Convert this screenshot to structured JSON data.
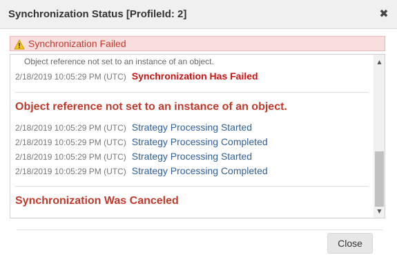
{
  "dialog": {
    "title": "Synchronization Status [ProfileId: 2]",
    "close_glyph": "✖"
  },
  "alert": {
    "icon": "warning-triangle-icon",
    "text": "Synchronization Failed"
  },
  "log": {
    "truncated_message": "Object reference not set to an instance of an object.",
    "entries_block1": [
      {
        "timestamp": "2/18/2019 10:05:29 PM (UTC)",
        "message": "Synchronization Has Failed"
      }
    ],
    "error_heading": "Object reference not set to an instance of an object.",
    "entries_block2": [
      {
        "timestamp": "2/18/2019 10:05:29 PM (UTC)",
        "message": "Strategy Processing Started"
      },
      {
        "timestamp": "2/18/2019 10:05:29 PM (UTC)",
        "message": "Strategy Processing Completed"
      },
      {
        "timestamp": "2/18/2019 10:05:29 PM (UTC)",
        "message": "Strategy Processing Started"
      },
      {
        "timestamp": "2/18/2019 10:05:29 PM (UTC)",
        "message": "Strategy Processing Completed"
      }
    ],
    "canceled_heading": "Synchronization Was Canceled"
  },
  "scrollbar": {
    "up_glyph": "▲",
    "down_glyph": "▼"
  },
  "footer": {
    "close_label": "Close"
  },
  "colors": {
    "error_red": "#c0392b",
    "failed_red": "#cc1111",
    "link_blue": "#2e5f99",
    "alert_bg": "#f9dede"
  }
}
